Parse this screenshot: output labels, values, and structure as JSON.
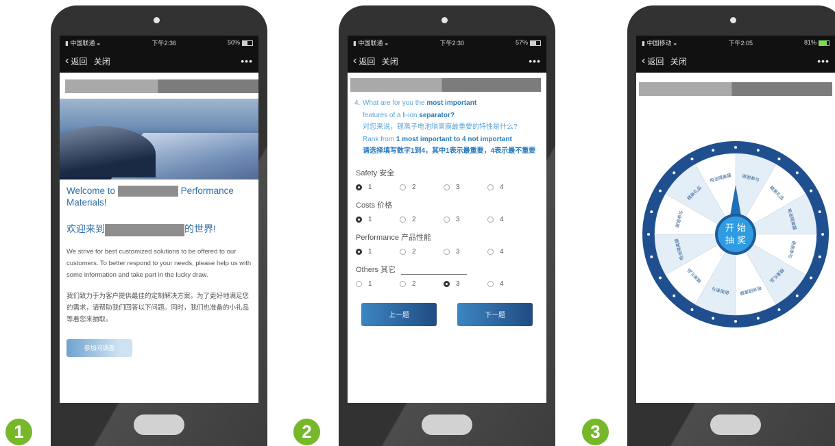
{
  "steps": [
    "1",
    "2",
    "3"
  ],
  "phones": [
    {
      "status": {
        "carrier": "中国联通",
        "time": "下午2:36",
        "battery": "50%",
        "battery_level": 0.5
      },
      "nav": {
        "back": "返回",
        "close": "关闭",
        "more": "•••"
      }
    },
    {
      "status": {
        "carrier": "中国联通",
        "time": "下午2:30",
        "battery": "57%",
        "battery_level": 0.57
      },
      "nav": {
        "back": "返回",
        "close": "关闭",
        "more": "•••"
      }
    },
    {
      "status": {
        "carrier": "中国移动",
        "time": "下午2:05",
        "battery": "81%",
        "battery_level": 0.81
      },
      "nav": {
        "back": "返回",
        "close": "关闭",
        "more": "•••"
      }
    }
  ],
  "welcome": {
    "en_prefix": "Welcome to",
    "en_suffix": "Performance",
    "en_line2": "Materials!",
    "cn_prefix": "欢迎来到",
    "cn_suffix": "的世界!",
    "paragraph_en": "We strive for best customized solutions to be offered to our customers. To better respond to your needs, please help us with some information and take part in the lucky draw.",
    "paragraph_cn": "我们致力于为客户提供最佳的定制解决方案。为了更好地满足您的需求，请帮助我们回答以下问题。同时，我们也准备的小礼品等着您来抽取。",
    "button": "参加问调查"
  },
  "survey": {
    "question_number": "4.",
    "question_en_1": "What are for you the",
    "question_en_1b": "most important",
    "question_en_2": "features of a li-ion",
    "question_en_2b": "separator?",
    "question_cn": "对您来说，锂离子电池隔离膜最重要的特性是什么?",
    "rank_en_1": "Rank from",
    "rank_en_1b": "1 most important to 4 not important",
    "rank_cn": "请选择填写数字1到4，其中1表示最重要，4表示最不重要",
    "criteria": [
      {
        "label": "Safety 安全",
        "options": [
          "1",
          "2",
          "3",
          "4"
        ],
        "selected": "1"
      },
      {
        "label": "Costs 价格",
        "options": [
          "1",
          "2",
          "3",
          "4"
        ],
        "selected": "1"
      },
      {
        "label": "Performance 产品性能",
        "options": [
          "1",
          "2",
          "3",
          "4"
        ],
        "selected": "1"
      },
      {
        "label": "Others 其它",
        "options": [
          "1",
          "2",
          "3",
          "4"
        ],
        "selected": "3"
      }
    ],
    "prev_button": "上一题",
    "next_button": "下一题"
  },
  "wheel": {
    "center_line1": "开 始",
    "center_line2": "抽 奖",
    "segments": [
      "谢谢参与",
      "精美礼品",
      "电池隔离膜",
      "谢谢参与",
      "精美礼品",
      "电池隔离膜",
      "谢谢参与",
      "精美礼品",
      "电池隔离膜",
      "谢谢参与",
      "精美礼品",
      "电池隔离膜"
    ],
    "colors": {
      "rim": "#1f4f8e",
      "segment_a": "#e4eef7",
      "segment_b": "#ffffff",
      "hub": "#2f9be0"
    }
  }
}
